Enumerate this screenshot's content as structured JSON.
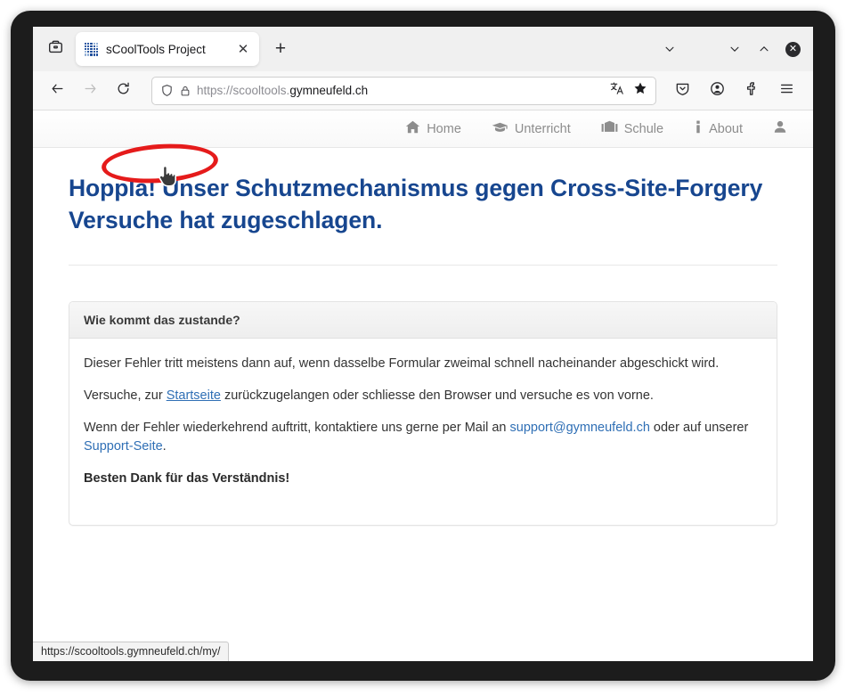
{
  "browser": {
    "firefox_view_label": "firefox-view",
    "tab": {
      "title": "sCoolTools Project",
      "close_label": "✕",
      "favicon": "dotted-grid-icon"
    },
    "new_tab_label": "+",
    "window_controls": {
      "tab_list": "⌄",
      "minimize": "⌄",
      "maximize": "⌃",
      "close": "✕"
    },
    "toolbar": {
      "back_icon": "back-arrow-icon",
      "forward_icon": "forward-arrow-icon",
      "reload_icon": "reload-icon",
      "shield_icon": "tracking-protection-shield-icon",
      "lock_icon": "padlock-icon",
      "translate_icon": "translate-icon",
      "bookmark_icon": "star-filled-icon",
      "pocket_icon": "pocket-save-icon",
      "account_icon": "account-circle-icon",
      "extensions_icon": "extensions-icon",
      "menu_icon": "hamburger-menu-icon"
    },
    "url": {
      "scheme_host_dim": "https://scooltools.",
      "host_strong": "gymneufeld.ch",
      "full": "https://scooltools.gymneufeld.ch"
    },
    "status_bar": {
      "link_url": "https://scooltools.gymneufeld.ch/my/"
    }
  },
  "site_nav": {
    "items": [
      {
        "label": "Home",
        "icon": "home-icon"
      },
      {
        "label": "Unterricht",
        "icon": "graduation-cap-icon"
      },
      {
        "label": "Schule",
        "icon": "university-building-icon"
      },
      {
        "label": "About",
        "icon": "info-icon"
      },
      {
        "label": "",
        "icon": "user-person-icon"
      }
    ]
  },
  "page": {
    "heading": "Hoppla! Unser Schutzmechanismus gegen Cross-Site-Forgery Versuche hat zugeschlagen.",
    "panel": {
      "header": "Wie kommt das zustande?",
      "paragraph_1": "Dieser Fehler tritt meistens dann auf, wenn dasselbe Formular zweimal schnell nacheinander abgeschickt wird.",
      "paragraph_2_before": "Versuche, zur ",
      "paragraph_2_link": "Startseite",
      "paragraph_2_after": " zurückzugelangen oder schliesse den Browser und versuche es von vorne.",
      "paragraph_3_before": "Wenn der Fehler wiederkehrend auftritt, kontaktiere uns gerne per Mail an ",
      "paragraph_3_link_mail": "support@gymneufeld.ch",
      "paragraph_3_middle": " oder auf unserer ",
      "paragraph_3_link_support": "Support-Seite",
      "paragraph_3_after": ".",
      "paragraph_4": "Besten Dank für das Verständnis!"
    }
  },
  "annotation": {
    "ellipse_color": "#e51b1b",
    "cursor_icon": "pointing-hand-cursor"
  },
  "colors": {
    "heading_blue": "#17468f",
    "link_blue": "#2f6fb5",
    "annotation_red": "#e51b1b"
  }
}
